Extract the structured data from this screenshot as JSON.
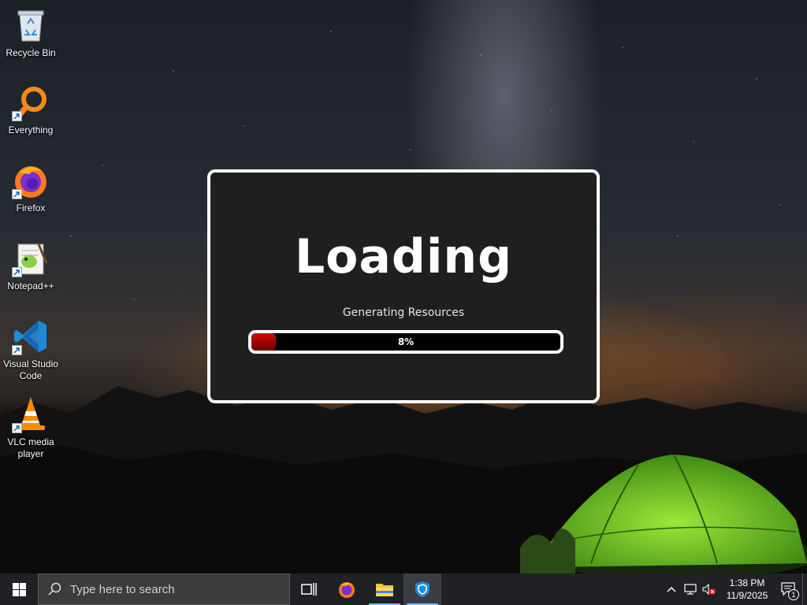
{
  "desktop": {
    "icons": [
      {
        "label": "Recycle Bin",
        "icon": "recycle-bin-icon"
      },
      {
        "label": "Everything",
        "icon": "everything-search-icon"
      },
      {
        "label": "Firefox",
        "icon": "firefox-icon"
      },
      {
        "label": "Notepad++",
        "icon": "notepad-plus-plus-icon"
      },
      {
        "label": "Visual Studio Code",
        "icon": "vscode-icon"
      },
      {
        "label": "VLC media player",
        "icon": "vlc-icon"
      }
    ]
  },
  "loading": {
    "title": "Loading",
    "subtitle": "Generating Resources",
    "progress_percent": 8,
    "progress_label": "8%",
    "border_color": "#ffffff",
    "fill_color": "#c00000"
  },
  "taskbar": {
    "search_placeholder": "Type here to search",
    "apps": [
      {
        "name": "task-view",
        "icon": "task-view-icon"
      },
      {
        "name": "firefox",
        "icon": "firefox-icon"
      },
      {
        "name": "file-explorer",
        "icon": "folder-icon"
      },
      {
        "name": "loading-app",
        "icon": "shield-app-icon",
        "active": true
      }
    ],
    "clock": {
      "time": "1:38 PM",
      "date": "11/9/2025"
    },
    "notification_count": "1"
  }
}
